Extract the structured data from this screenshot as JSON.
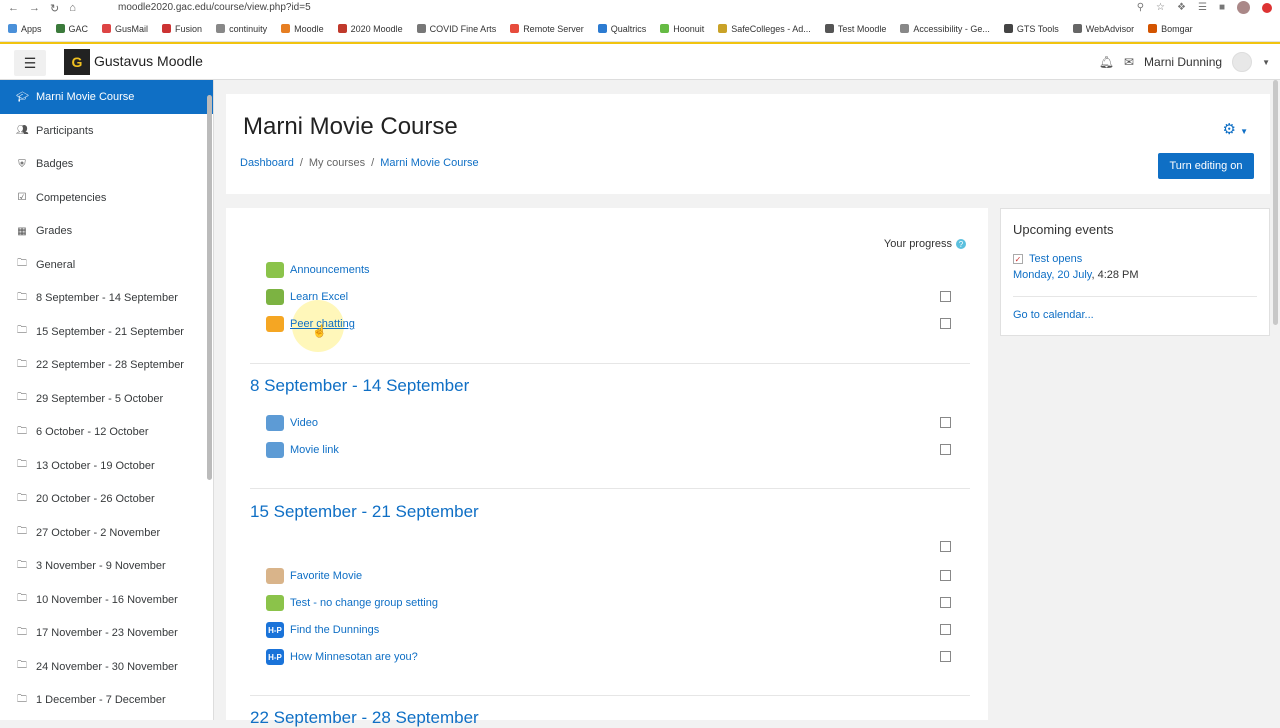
{
  "browser": {
    "url": "moodle2020.gac.edu/course/view.php?id=5",
    "bookmarks": [
      "Apps",
      "GAC",
      "GusMail",
      "Fusion",
      "continuity",
      "Moodle",
      "2020 Moodle",
      "COVID Fine Arts",
      "Remote Server",
      "Qualtrics",
      "Hoonuit",
      "SafeColleges - Ad...",
      "Test Moodle",
      "Accessibility - Ge...",
      "GTS Tools",
      "WebAdvisor",
      "Bomgar"
    ]
  },
  "navbar": {
    "brand": "Gustavus Moodle",
    "user_name": "Marni Dunning"
  },
  "sidebar": {
    "items": [
      {
        "label": "Marni Movie Course",
        "icon": "graduation-cap-icon",
        "active": true
      },
      {
        "label": "Participants",
        "icon": "users-icon"
      },
      {
        "label": "Badges",
        "icon": "shield-icon"
      },
      {
        "label": "Competencies",
        "icon": "check-square-icon"
      },
      {
        "label": "Grades",
        "icon": "table-icon"
      },
      {
        "label": "General",
        "icon": "folder-icon"
      },
      {
        "label": "8 September - 14 September",
        "icon": "folder-icon"
      },
      {
        "label": "15 September - 21 September",
        "icon": "folder-icon"
      },
      {
        "label": "22 September - 28 September",
        "icon": "folder-icon"
      },
      {
        "label": "29 September - 5 October",
        "icon": "folder-icon"
      },
      {
        "label": "6 October - 12 October",
        "icon": "folder-icon"
      },
      {
        "label": "13 October - 19 October",
        "icon": "folder-icon"
      },
      {
        "label": "20 October - 26 October",
        "icon": "folder-icon"
      },
      {
        "label": "27 October - 2 November",
        "icon": "folder-icon"
      },
      {
        "label": "3 November - 9 November",
        "icon": "folder-icon"
      },
      {
        "label": "10 November - 16 November",
        "icon": "folder-icon"
      },
      {
        "label": "17 November - 23 November",
        "icon": "folder-icon"
      },
      {
        "label": "24 November - 30 November",
        "icon": "folder-icon"
      },
      {
        "label": "1 December - 7 December",
        "icon": "folder-icon"
      }
    ]
  },
  "header": {
    "title": "Marni Movie Course",
    "breadcrumb": [
      "Dashboard",
      "My courses",
      "Marni Movie Course"
    ],
    "edit_button": "Turn editing on"
  },
  "main": {
    "progress_label": "Your progress",
    "general_activities": [
      {
        "label": "Announcements",
        "icon": "forum-icon"
      },
      {
        "label": "Learn Excel",
        "icon": "puzzle-icon"
      },
      {
        "label": "Peer chatting",
        "icon": "chat-icon"
      }
    ],
    "sections": [
      {
        "title": "8 September - 14 September",
        "activities": [
          {
            "label": "Video",
            "icon": "url-icon"
          },
          {
            "label": "Movie link",
            "icon": "url-icon"
          }
        ]
      },
      {
        "title": "15 September - 21 September",
        "activities": [
          {
            "label": "Favorite Movie",
            "icon": "assignment-icon"
          },
          {
            "label": "Test - no change group setting",
            "icon": "forum-icon"
          },
          {
            "label": "Find the Dunnings",
            "icon": "h5p-icon"
          },
          {
            "label": "How Minnesotan are you?",
            "icon": "h5p-icon"
          }
        ]
      },
      {
        "title": "22 September - 28 September",
        "activities": []
      }
    ],
    "h5p_icon_text": "H-P"
  },
  "upcoming": {
    "title": "Upcoming events",
    "event_name": "Test opens",
    "event_date": "Monday, 20 July",
    "event_time": ", 4:28 PM",
    "calendar_link": "Go to calendar..."
  }
}
